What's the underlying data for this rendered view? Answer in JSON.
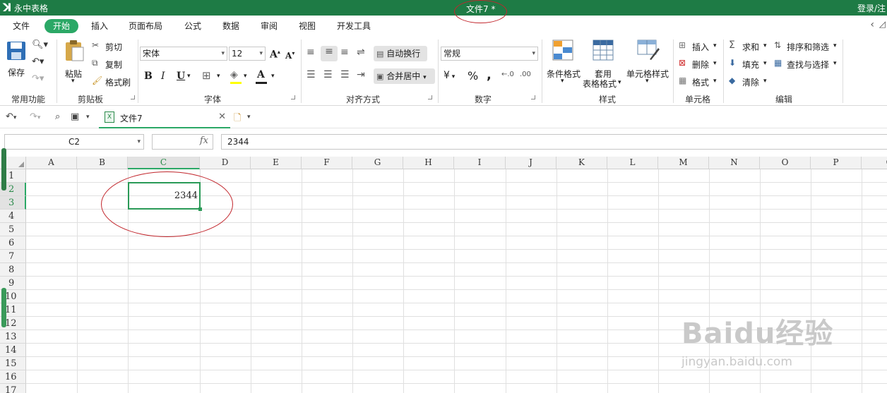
{
  "app": {
    "name": "永中表格",
    "document_title": "文件7 *",
    "login_text": "登录/注"
  },
  "menu": {
    "items": [
      "文件",
      "开始",
      "插入",
      "页面布局",
      "公式",
      "数据",
      "审阅",
      "视图",
      "开发工具"
    ],
    "active": "开始"
  },
  "ribbon": {
    "common": {
      "save": "保存",
      "group": "常用功能"
    },
    "clipboard": {
      "paste": "粘贴",
      "cut": "剪切",
      "copy": "复制",
      "format_painter": "格式刷",
      "group": "剪贴板"
    },
    "font": {
      "family": "宋体",
      "size": "12",
      "grow": "A",
      "shrink": "A",
      "bold": "B",
      "italic": "I",
      "underline": "U",
      "color_letter": "A",
      "group": "字体"
    },
    "align": {
      "wrap": "自动换行",
      "merge": "合并居中",
      "group": "对齐方式"
    },
    "number": {
      "format": "常规",
      "currency": "¥",
      "percent": "%",
      "comma": ",",
      "group": "数字"
    },
    "styles": {
      "cond": "条件格式",
      "table_1": "套用",
      "table_2": "表格格式",
      "cell_style": "单元格样式",
      "group": "样式"
    },
    "cells": {
      "insert": "插入",
      "delete": "删除",
      "format": "格式",
      "group": "单元格"
    },
    "edit": {
      "sum": "求和",
      "sort": "排序和筛选",
      "fill": "填充",
      "find": "查找与选择",
      "clear": "清除",
      "group": "编辑"
    }
  },
  "tabbar": {
    "doc_tab": "文件7"
  },
  "formula_bar": {
    "name_box": "C2",
    "fx": "fx",
    "value": "2344"
  },
  "sheet": {
    "columns": [
      "A",
      "B",
      "C",
      "D",
      "E",
      "F",
      "G",
      "H",
      "I",
      "J",
      "K",
      "L",
      "M",
      "N",
      "O",
      "P",
      "Q"
    ],
    "rows": [
      "1",
      "2",
      "3",
      "4",
      "5",
      "6",
      "7",
      "8",
      "9",
      "10",
      "11",
      "12",
      "13",
      "14",
      "15",
      "16",
      "17"
    ],
    "selected_cell": "C2",
    "selected_value": "2344"
  },
  "watermark": {
    "brand": "Baidu经验",
    "url": "jingyan.baidu.com"
  },
  "colors": {
    "title_bar": "#1e7b45",
    "accent": "#2ba866",
    "annotation": "#c2272d"
  }
}
